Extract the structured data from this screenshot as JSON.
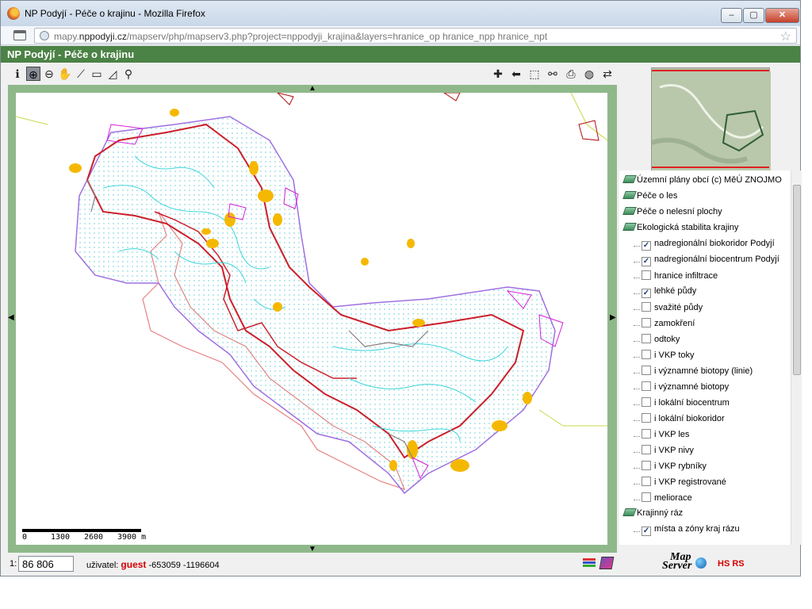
{
  "browser": {
    "window_title": "NP Podyjí - Péče o krajinu - Mozilla Firefox",
    "url_prefix": "mapy.",
    "url_domain": "nppodyji.cz",
    "url_path": "/mapserv/php/mapserv3.php?project=nppodyji_krajina&layers=hranice_op hranice_npp hranice_npt",
    "buttons": {
      "minimize": "–",
      "maximize": "▢",
      "close": "✕"
    }
  },
  "app": {
    "title": "NP Podyjí - Péče o krajinu"
  },
  "toolbar": {
    "left_tools": [
      {
        "name": "info-tool",
        "glyph": "ℹ"
      },
      {
        "name": "zoom-in-tool",
        "glyph": "⊕",
        "active": true
      },
      {
        "name": "zoom-out-tool",
        "glyph": "⊖"
      },
      {
        "name": "pan-tool",
        "glyph": "✋"
      },
      {
        "name": "measure-tool",
        "glyph": "⟋"
      },
      {
        "name": "area-tool",
        "glyph": "▭"
      },
      {
        "name": "profile-tool",
        "glyph": "◿"
      },
      {
        "name": "search-pin-tool",
        "glyph": "⚲"
      }
    ],
    "right_tools": [
      {
        "name": "zoom-full-tool",
        "glyph": "✚"
      },
      {
        "name": "back-tool",
        "glyph": "⬅"
      },
      {
        "name": "select-rect-tool",
        "glyph": "⬚"
      },
      {
        "name": "binoculars-tool",
        "glyph": "⚯"
      },
      {
        "name": "print-tool",
        "glyph": "⎙"
      },
      {
        "name": "globe-tool",
        "glyph": "◍"
      },
      {
        "name": "refresh-tool",
        "glyph": "⇄"
      }
    ]
  },
  "map": {
    "pan_arrows": {
      "up": "▲",
      "down": "▼",
      "left": "◀",
      "right": "▶"
    },
    "scale_labels": [
      "0",
      "1300",
      "2600",
      "3900 m"
    ]
  },
  "status": {
    "scale_prefix": "1:",
    "scale_value": "86 806",
    "user_label": "uživatel:",
    "user_name": "guest",
    "coordinates": "-653059 -1196604"
  },
  "legend": {
    "items": [
      {
        "type": "group",
        "label": "Územní plány obcí (c) MěÚ ZNOJMO"
      },
      {
        "type": "group",
        "label": "Péče o les"
      },
      {
        "type": "group",
        "label": "Péče o nelesní plochy"
      },
      {
        "type": "group",
        "label": "Ekologická stabilita krajiny"
      },
      {
        "type": "layer",
        "label": "nadregionální biokoridor Podyjí",
        "checked": true
      },
      {
        "type": "layer",
        "label": "nadregionální biocentrum Podyjí",
        "checked": true
      },
      {
        "type": "layer",
        "label": "hranice infiltrace",
        "checked": false
      },
      {
        "type": "layer",
        "label": "lehké půdy",
        "checked": true
      },
      {
        "type": "layer",
        "label": "svažité půdy",
        "checked": false
      },
      {
        "type": "layer",
        "label": "zamokření",
        "checked": false
      },
      {
        "type": "layer",
        "label": "odtoky",
        "checked": false
      },
      {
        "type": "layer",
        "label": "i VKP toky",
        "checked": false
      },
      {
        "type": "layer",
        "label": "i významné biotopy (linie)",
        "checked": false
      },
      {
        "type": "layer",
        "label": "i významné biotopy",
        "checked": false
      },
      {
        "type": "layer",
        "label": "i lokální biocentrum",
        "checked": false
      },
      {
        "type": "layer",
        "label": "i lokální biokoridor",
        "checked": false
      },
      {
        "type": "layer",
        "label": "i VKP les",
        "checked": false
      },
      {
        "type": "layer",
        "label": "i VKP nivy",
        "checked": false
      },
      {
        "type": "layer",
        "label": "i VKP rybníky",
        "checked": false
      },
      {
        "type": "layer",
        "label": "i VKP registrované",
        "checked": false
      },
      {
        "type": "layer",
        "label": "meliorace",
        "checked": false
      },
      {
        "type": "group",
        "label": "Krajinný ráz"
      },
      {
        "type": "layer",
        "label": "místa a zóny kraj rázu",
        "checked": true
      }
    ]
  },
  "logos": {
    "mapserver_line1": "Map",
    "mapserver_line2": "Server",
    "hsrs": "HS RS"
  },
  "colors": {
    "header_green": "#4b8245",
    "map_frame_green": "#8fb88a",
    "park_boundary_red": "#cc1f2a",
    "outer_boundary_salmon": "#e88080",
    "stream_cyan": "#3ed6dc",
    "light_soil_orange": "#f5b800",
    "corridor_purple": "#a070e0",
    "user_name_red": "#d40000"
  }
}
